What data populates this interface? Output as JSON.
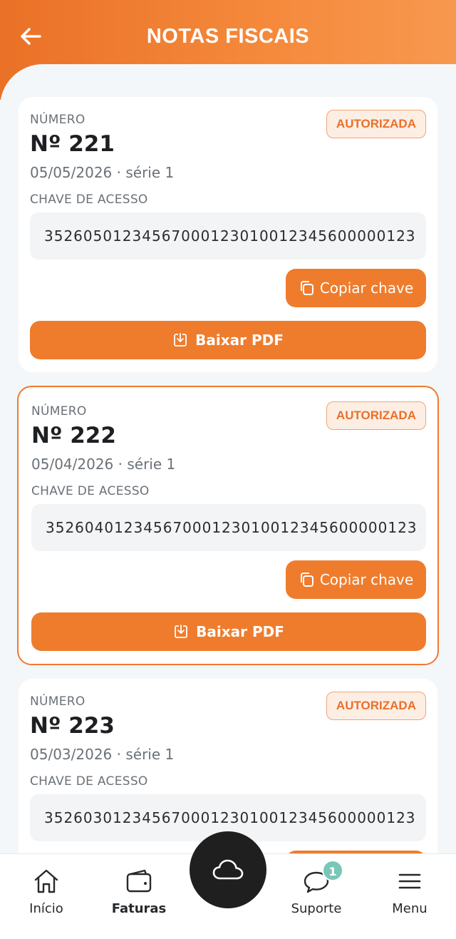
{
  "header": {
    "title": "NOTAS FISCAIS"
  },
  "labels": {
    "numero": "NÚMERO",
    "chave": "CHAVE DE ACESSO",
    "copy": "Copiar chave",
    "pdf": "Baixar PDF"
  },
  "invoices": [
    {
      "number": "Nº 221",
      "date": "05/05/2026 · série 1",
      "status": "AUTORIZADA",
      "key": "35260501234567000123010012345600000123"
    },
    {
      "number": "Nº 222",
      "date": "05/04/2026 · série 1",
      "status": "AUTORIZADA",
      "key": "35260401234567000123010012345600000123"
    },
    {
      "number": "Nº 223",
      "date": "05/03/2026 · série 1",
      "status": "AUTORIZADA",
      "key": "35260301234567000123010012345600000123"
    }
  ],
  "nav": {
    "items": [
      {
        "label": "Início",
        "icon": "home-icon"
      },
      {
        "label": "Faturas",
        "icon": "wallet-icon"
      },
      {
        "label": "Suporte",
        "icon": "chat-icon",
        "badge": "1"
      },
      {
        "label": "Menu",
        "icon": "hamburger-menu-icon"
      }
    ],
    "fab_icon": "cloud-icon"
  },
  "colors": {
    "accent": "#ef7c2d",
    "badge_bg": "#fdeee4",
    "badge_text": "#e8702a",
    "notif": "#79c7b6"
  }
}
